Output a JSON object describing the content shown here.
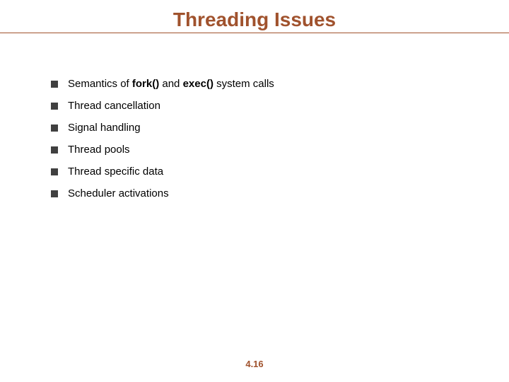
{
  "title": "Threading Issues",
  "bullets": [
    {
      "prefix": "Semantics of ",
      "bold1": "fork()",
      "mid": " and ",
      "bold2": "exec()",
      "suffix": " system calls"
    },
    {
      "text": "Thread cancellation"
    },
    {
      "text": "Signal handling"
    },
    {
      "text": "Thread pools"
    },
    {
      "text": "Thread specific data"
    },
    {
      "text": "Scheduler activations"
    }
  ],
  "page_number": "4.16"
}
